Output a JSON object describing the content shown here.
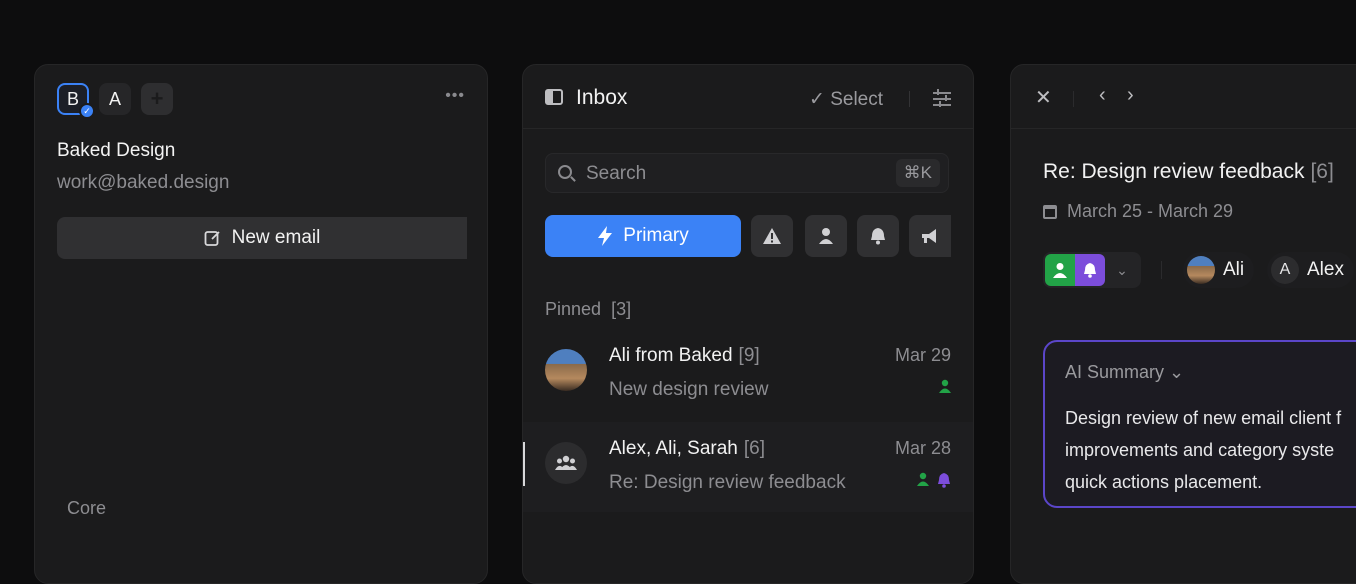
{
  "accounts": {
    "items": [
      {
        "initial": "B",
        "selected": true
      },
      {
        "initial": "A",
        "selected": false
      }
    ],
    "add_label": "+",
    "more_label": "•••",
    "name": "Baked Design",
    "email": "work@baked.design",
    "new_email_label": "New email",
    "core_label": "Core"
  },
  "inbox": {
    "title": "Inbox",
    "select_label": "✓ Select",
    "search_placeholder": "Search",
    "search_shortcut": "⌘K",
    "primary_label": "Primary",
    "category_icons": [
      "warning-icon",
      "person-icon",
      "bell-icon",
      "megaphone-icon"
    ],
    "pinned_label": "Pinned",
    "pinned_count": "[3]",
    "threads": [
      {
        "from": "Ali from Baked",
        "count": "[9]",
        "date": "Mar 29",
        "subject": "New design review",
        "tags": [
          "green"
        ]
      },
      {
        "from": "Alex, Ali, Sarah",
        "count": "[6]",
        "date": "Mar 28",
        "subject": "Re: Design review feedback",
        "tags": [
          "green",
          "purple"
        ]
      }
    ],
    "colors": {
      "accent": "#3b82f6",
      "tag_green": "#22a347",
      "tag_purple": "#7c4ddb"
    }
  },
  "thread": {
    "title": "Re: Design review feedback",
    "count": "[6]",
    "date_range": "March 25 - March 29",
    "participants": [
      {
        "name": "Ali"
      },
      {
        "name": "Alex",
        "initial": "A"
      }
    ],
    "ai_summary_title": "AI Summary",
    "ai_summary_lines": [
      "Design review of new email client f",
      "improvements and category syste",
      "quick actions placement."
    ]
  }
}
